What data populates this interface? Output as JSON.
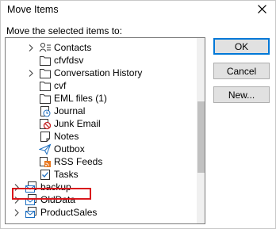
{
  "window": {
    "title": "Move Items"
  },
  "prompt": "Move the selected items to:",
  "buttons": {
    "ok": "OK",
    "cancel": "Cancel",
    "new": "New..."
  },
  "folders": [
    {
      "label": "Contacts",
      "icon": "contacts-icon"
    },
    {
      "label": "cfvfdsv",
      "icon": "folder-icon"
    },
    {
      "label": "Conversation History",
      "icon": "folder-icon"
    },
    {
      "label": "cvf",
      "icon": "folder-icon"
    },
    {
      "label": "EML files (1)",
      "icon": "folder-icon"
    },
    {
      "label": "Journal",
      "icon": "journal-icon"
    },
    {
      "label": "Junk Email",
      "icon": "junk-email-icon"
    },
    {
      "label": "Notes",
      "icon": "notes-icon"
    },
    {
      "label": "Outbox",
      "icon": "outbox-icon"
    },
    {
      "label": "RSS Feeds",
      "icon": "rss-feeds-icon"
    },
    {
      "label": "Tasks",
      "icon": "tasks-icon"
    },
    {
      "label": "backup",
      "icon": "mailbox-icon"
    },
    {
      "label": "OldData",
      "icon": "mailbox-icon"
    },
    {
      "label": "ProductSales",
      "icon": "mailbox-icon"
    }
  ],
  "colors": {
    "highlight_border": "#d9161c",
    "default_button_border": "#0078d7"
  }
}
